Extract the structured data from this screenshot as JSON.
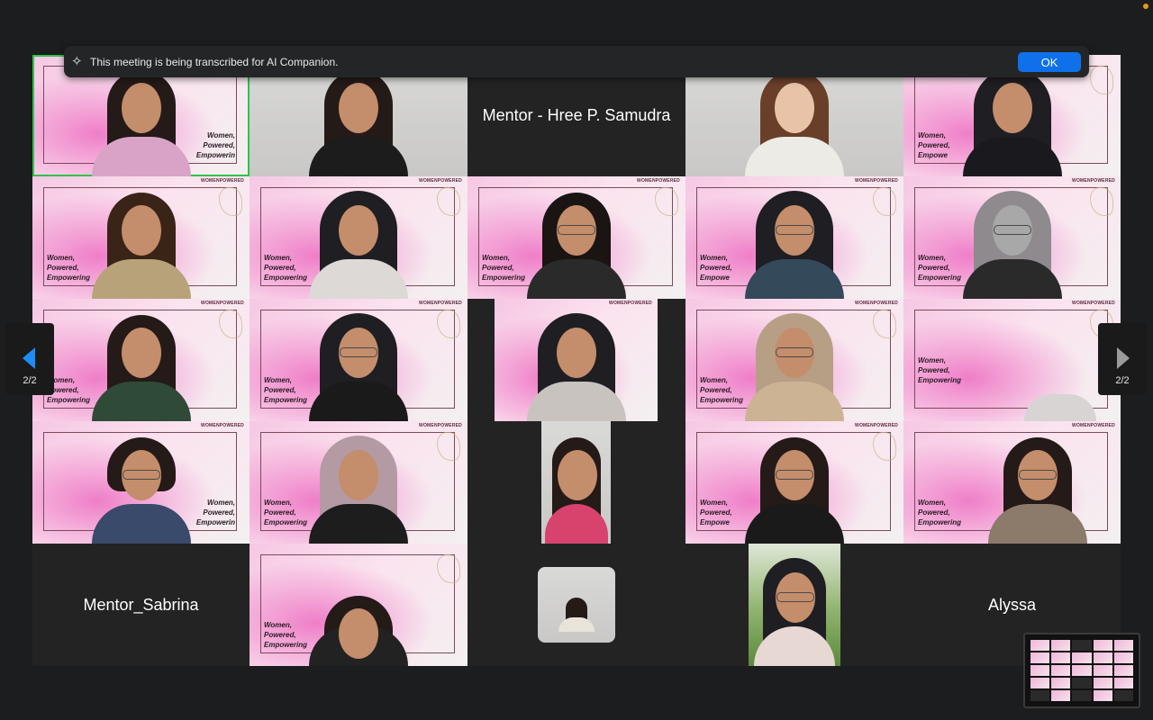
{
  "banner": {
    "message": "This meeting is being transcribed for AI Companion.",
    "ok_label": "OK",
    "icon": "sparkle-icon"
  },
  "pager": {
    "left": "2/2",
    "right": "2/2"
  },
  "tiles": {
    "mentor_hree": "Mentor - Hree P. Samudra",
    "mentor_sabrina": "Mentor_Sabrina",
    "alyssa": "Alyssa"
  },
  "background_text": {
    "brand": "WOMENPOWERED",
    "slogan_line1": "Women,",
    "slogan_line2": "Powered,",
    "slogan_line3": "Empowering",
    "slogan_line3_cut": "Empowerin",
    "slogan_line3_cut2": "Empowe"
  },
  "colors": {
    "ok_button": "#0e71eb",
    "active_speaker": "#2fc24b",
    "pager_left_arrow": "#1d8df5",
    "background": "#1c1d1f"
  }
}
